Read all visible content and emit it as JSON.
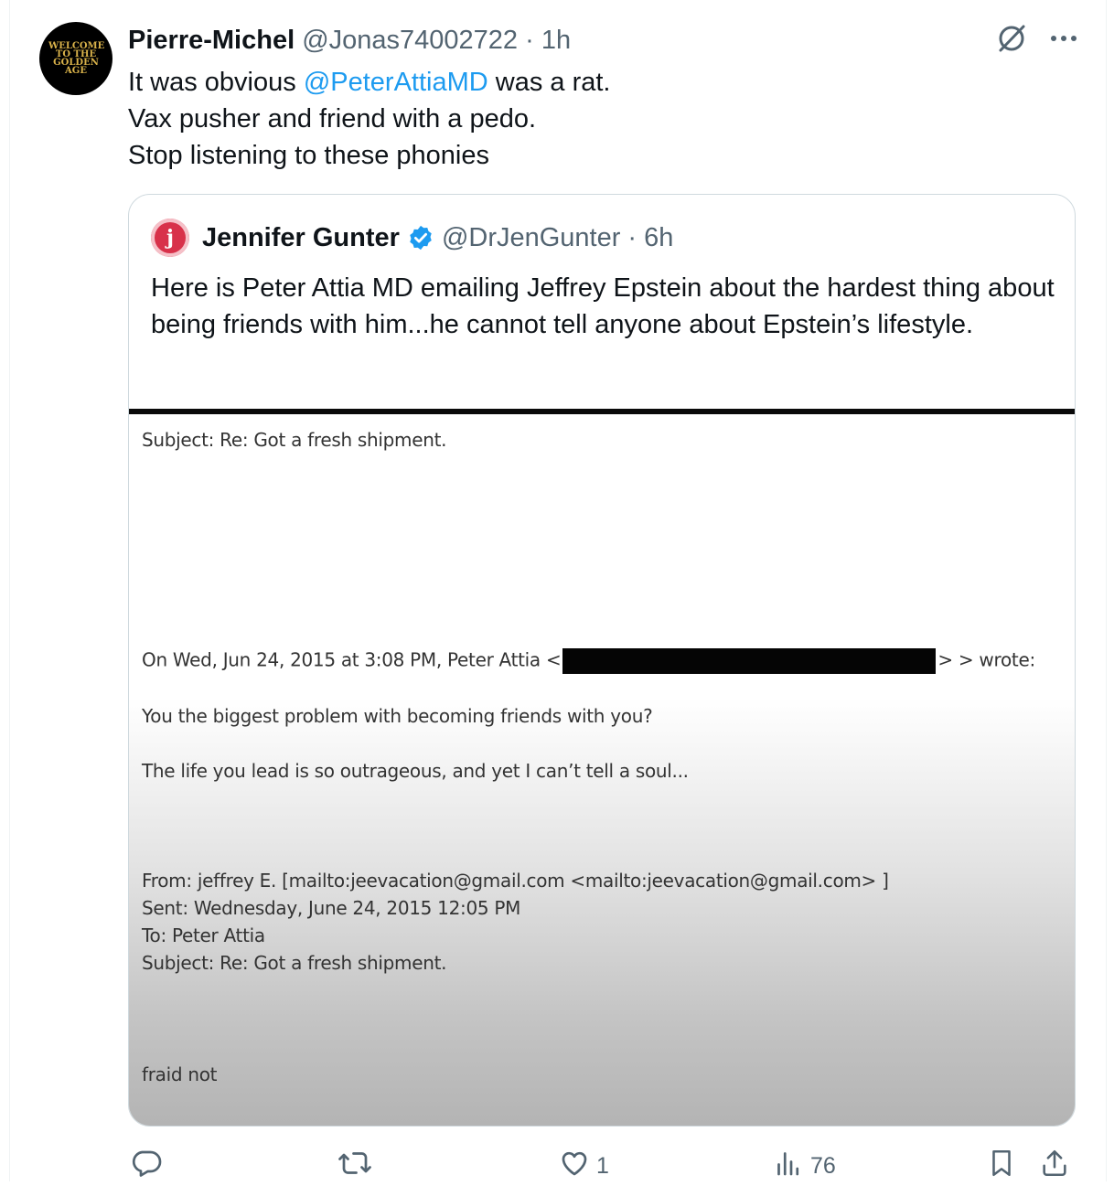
{
  "tweet": {
    "avatar_text": "WELCOME TO THE GOLDEN AGE",
    "display_name": "Pierre-Michel",
    "handle": "@Jonas74002722",
    "time": "· 1h",
    "line1_before": "It was obvious ",
    "line1_mention": "@PeterAttiaMD",
    "line1_after": " was a rat.",
    "line2": "Vax pusher and friend with a pedo.",
    "line3": "Stop listening to these phonies"
  },
  "quote": {
    "avatar_letter": "j",
    "display_name": "Jennifer Gunter",
    "handle": "@DrJenGunter",
    "time": "· 6h",
    "text": "Here is Peter Attia MD emailing Jeffrey Epstein about the hardest thing about being friends with him...he cannot tell anyone about Epstein’s lifestyle.",
    "document": {
      "subject_top": "Subject: Re: Got a fresh shipment.",
      "on_wed_prefix": "On Wed, Jun 24, 2015 at 3:08 PM, Peter Attia <",
      "on_wed_suffix": "> > wrote:",
      "line_problem": "You the biggest problem with becoming friends with you?",
      "line_life": "The life you lead is so outrageous, and yet I can’t tell a soul...",
      "from": "From: jeffrey E. [mailto:jeevacation@gmail.com <mailto:jeevacation@gmail.com> ]",
      "sent": "Sent: Wednesday, June 24, 2015 12:05 PM",
      "to": "To: Peter Attia",
      "subject_bottom": "Subject: Re: Got a fresh shipment.",
      "fraid": "fraid not"
    }
  },
  "actions": {
    "reply_count": "",
    "retweet_count": "",
    "like_count": "1",
    "views_count": "76"
  },
  "icons": [
    "grok-icon",
    "more-icon",
    "verified-icon",
    "reply-icon",
    "retweet-icon",
    "like-icon",
    "views-icon",
    "bookmark-icon",
    "share-icon"
  ],
  "colors": {
    "link": "#1d9bf0",
    "muted": "#536471",
    "verified": "#1d9bf0"
  }
}
